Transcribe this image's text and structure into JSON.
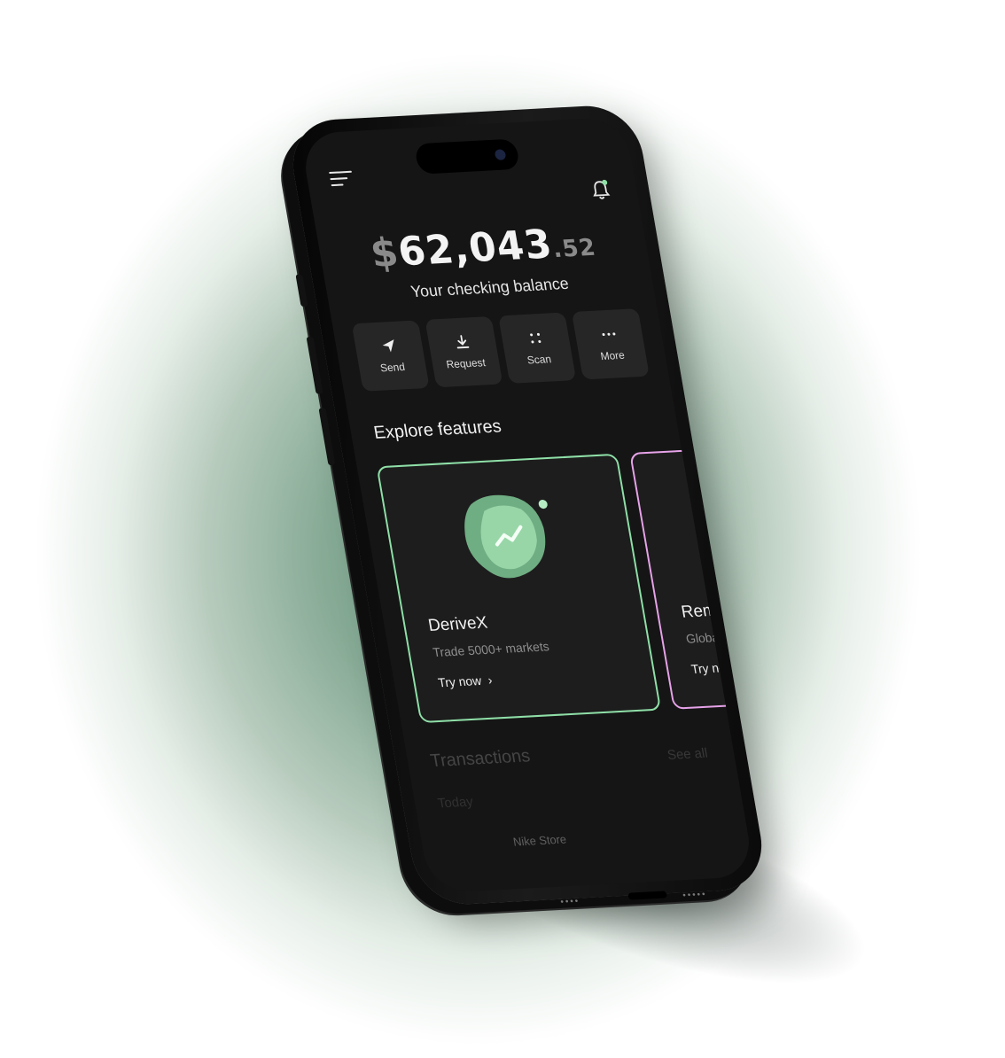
{
  "balance": {
    "currency": "$",
    "integer": "62,043",
    "cents": ".52",
    "label": "Your checking balance"
  },
  "actions": [
    {
      "label": "Send",
      "icon": "send-icon"
    },
    {
      "label": "Request",
      "icon": "download-icon"
    },
    {
      "label": "Scan",
      "icon": "scan-icon"
    },
    {
      "label": "More",
      "icon": "more-icon"
    }
  ],
  "explore": {
    "title": "Explore features",
    "cards": [
      {
        "title": "DeriveX",
        "subtitle": "Trade 5000+ markets",
        "cta": "Try now",
        "accent": "#8fe0a8",
        "icon": "trend-chart-icon"
      },
      {
        "title": "RemmiteX",
        "subtitle": "Global payments",
        "cta": "Try now",
        "accent": "#e7a3e9",
        "icon": "heart-icon"
      }
    ]
  },
  "transactions": {
    "title": "Transactions",
    "see_all": "See all",
    "group": "Today",
    "items": [
      {
        "merchant": "Nike Store"
      }
    ]
  },
  "colors": {
    "background": "#7fa38e",
    "screen": "#151515",
    "green_accent": "#8fe0a8",
    "pink_accent": "#e7a3e9"
  }
}
